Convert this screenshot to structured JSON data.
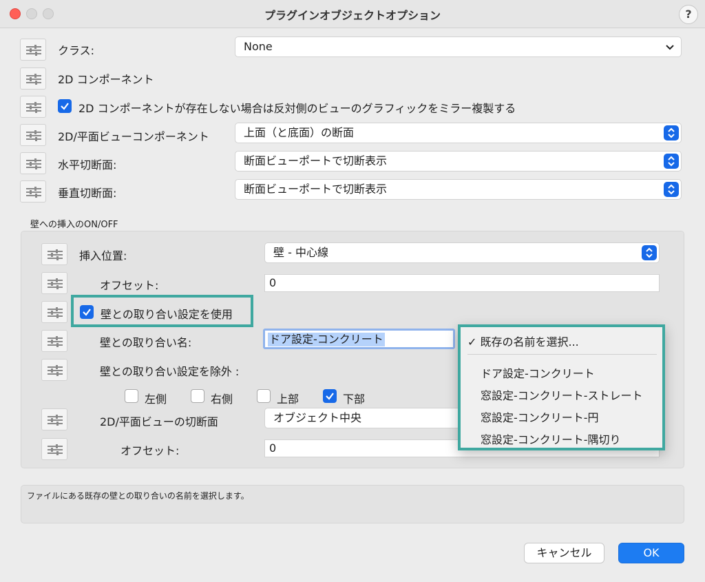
{
  "window": {
    "title": "プラグインオブジェクトオプション",
    "help": "?"
  },
  "rows": {
    "class_label": "クラス:",
    "class_value": "None",
    "comp2d_label": "2D コンポーネント",
    "mirror_label": "2D コンポーネントが存在しない場合は反対側のビューのグラフィックをミラー複製する",
    "planview_label": "2D/平面ビューコンポーネント",
    "planview_value": "上面（と底面）の断面",
    "hcut_label": "水平切断面:",
    "hcut_value": "断面ビューポートで切断表示",
    "vcut_label": "垂直切断面:",
    "vcut_value": "断面ビューポートで切断表示"
  },
  "wall": {
    "group_label": "壁への挿入のON/OFF",
    "insert_pos_label": "挿入位置:",
    "insert_pos_value": "壁 - 中心線",
    "offset_label": "オフセット:",
    "offset_value": "0",
    "use_closure_label": "壁との取り合い設定を使用",
    "closure_name_label": "壁との取り合い名:",
    "closure_name_value": "ドア設定-コンクリート",
    "exclude_label": "壁との取り合い設定を除外 :",
    "exclude_left": "左側",
    "exclude_right": "右側",
    "exclude_top": "上部",
    "exclude_bottom": "下部",
    "cut2d_label": "2D/平面ビューの切断面",
    "cut2d_value": "オブジェクト中央",
    "offset2_label": "オフセット:",
    "offset2_value": "0"
  },
  "menu": {
    "items": [
      {
        "label": "既存の名前を選択...",
        "checked": true
      },
      {
        "label": "ドア設定-コンクリート"
      },
      {
        "label": "窓設定-コンクリート-ストレート"
      },
      {
        "label": "窓設定-コンクリート-円"
      },
      {
        "label": "窓設定-コンクリート-隅切り"
      }
    ]
  },
  "description": "ファイルにある既存の壁との取り合いの名前を選択します。",
  "buttons": {
    "cancel": "キャンセル",
    "ok": "OK"
  },
  "colors": {
    "accent": "#1769e8",
    "highlight": "#3fa8a0",
    "ok_button": "#1d7cf2"
  }
}
